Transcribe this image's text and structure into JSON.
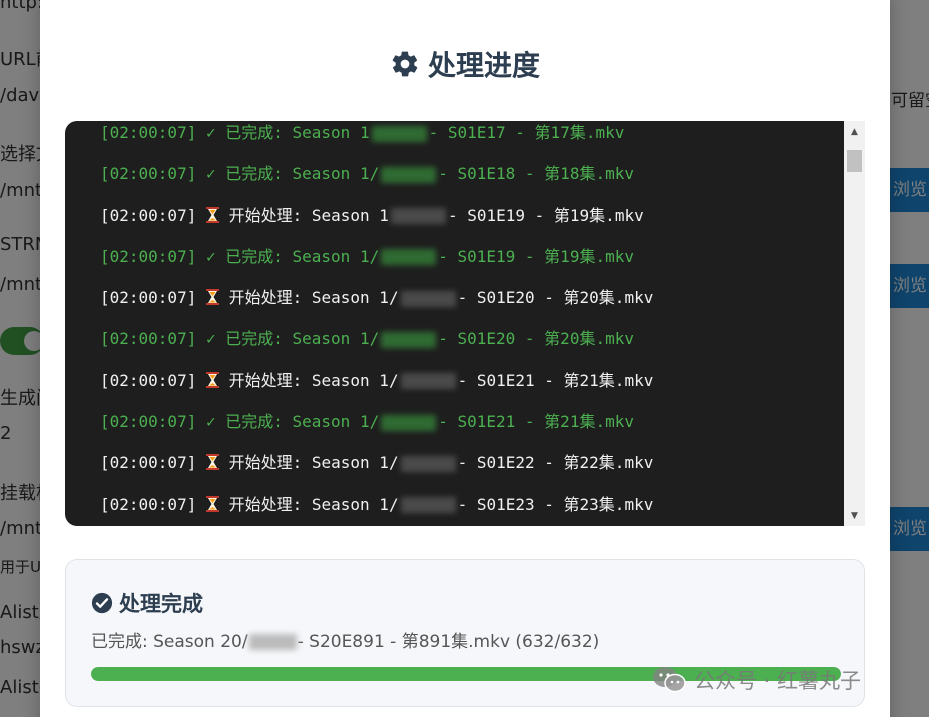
{
  "background": {
    "left_labels": [
      "http:/",
      "URL前",
      "/dav",
      "选择文",
      "/mnt/",
      "STRM",
      "/mnt/",
      "生成间",
      "2",
      "挂载根",
      "/mnt/",
      "用于UR",
      "Alist账",
      "hswz",
      "Alist密"
    ],
    "right_text": "可留空",
    "browse_label": "浏览"
  },
  "modal": {
    "title": "处理进度",
    "title_icon": "gear-icon",
    "log_lines": [
      {
        "time": "[02:00:07]",
        "mark": "✓",
        "text": "已完成: Season 1",
        "tail": "- S01E17 - 第17集.mkv",
        "status": "done"
      },
      {
        "time": "[02:00:07]",
        "mark": "✓",
        "text": "已完成: Season 1/",
        "tail": "- S01E18 - 第18集.mkv",
        "status": "done"
      },
      {
        "time": "[02:00:07]",
        "mark": "hourglass",
        "text": "开始处理: Season 1",
        "tail": "- S01E19 - 第19集.mkv",
        "status": "start"
      },
      {
        "time": "[02:00:07]",
        "mark": "✓",
        "text": "已完成: Season 1/",
        "tail": "- S01E19 - 第19集.mkv",
        "status": "done"
      },
      {
        "time": "[02:00:07]",
        "mark": "hourglass",
        "text": "开始处理: Season 1/",
        "tail": "- S01E20 - 第20集.mkv",
        "status": "start"
      },
      {
        "time": "[02:00:07]",
        "mark": "✓",
        "text": "已完成: Season 1/",
        "tail": "- S01E20 - 第20集.mkv",
        "status": "done"
      },
      {
        "time": "[02:00:07]",
        "mark": "hourglass",
        "text": "开始处理: Season 1/",
        "tail": "- S01E21 - 第21集.mkv",
        "status": "start"
      },
      {
        "time": "[02:00:07]",
        "mark": "✓",
        "text": "已完成: Season 1/",
        "tail": "- S01E21 - 第21集.mkv",
        "status": "done"
      },
      {
        "time": "[02:00:07]",
        "mark": "hourglass",
        "text": "开始处理: Season 1/",
        "tail": "- S01E22 - 第22集.mkv",
        "status": "start"
      },
      {
        "time": "[02:00:07]",
        "mark": "hourglass",
        "text": "开始处理: Season 1/",
        "tail": "- S01E23 - 第23集.mkv",
        "status": "start"
      }
    ],
    "status": {
      "heading": "处理完成",
      "heading_icon": "check-circle-icon",
      "detail_prefix": "已完成: Season 20/",
      "detail_suffix": "- S20E891 - 第891集.mkv (632/632)",
      "progress": 1.0,
      "progress_color": "#4caf50"
    }
  },
  "watermark": {
    "text": "公众号 · 红薯丸子",
    "icon": "wechat-icon"
  },
  "colors": {
    "done": "#4caf50",
    "start": "#f0f0f0",
    "console_bg": "#1e1e1e",
    "title": "#2c3e50",
    "browse_button": "#1e88d8"
  }
}
